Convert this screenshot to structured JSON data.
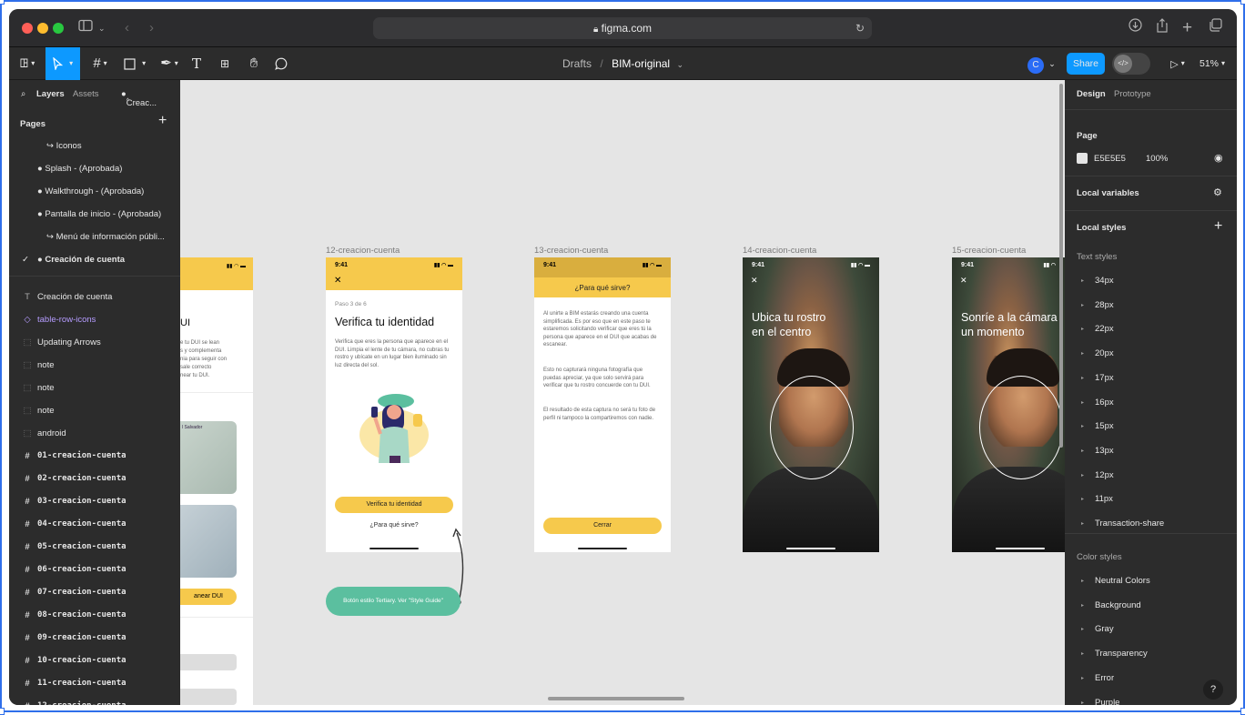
{
  "browser": {
    "url": "figma.com"
  },
  "toolbar": {
    "breadcrumb_drafts": "Drafts",
    "breadcrumb_separator": "/",
    "file_name": "BIM-original",
    "avatar_letter": "C",
    "share_label": "Share",
    "zoom": "51%"
  },
  "left_panel": {
    "tabs": {
      "layers": "Layers",
      "assets": "Assets",
      "page_dropdown": "Creac..."
    },
    "pages_header": "Pages",
    "pages": [
      {
        "label": "↪ Iconos"
      },
      {
        "label": "● Splash - (Aprobada)"
      },
      {
        "label": "● Walkthrough - (Aprobada)"
      },
      {
        "label": "● Pantalla de inicio - (Aprobada)"
      },
      {
        "label": "↪ Menú de información públi..."
      },
      {
        "label": "● Creación de cuenta",
        "selected": true
      }
    ],
    "layers": [
      {
        "icon": "text-icon",
        "label": "Creación de cuenta"
      },
      {
        "icon": "component-icon",
        "label": "table-row-icons",
        "color": "#b59cff"
      },
      {
        "icon": "section-icon",
        "label": "Updating Arrows"
      },
      {
        "icon": "section-icon",
        "label": "note"
      },
      {
        "icon": "section-icon",
        "label": "note"
      },
      {
        "icon": "section-icon",
        "label": "note"
      },
      {
        "icon": "section-icon",
        "label": "android"
      },
      {
        "icon": "frame-icon",
        "label": "01-creacion-cuenta"
      },
      {
        "icon": "frame-icon",
        "label": "02-creacion-cuenta"
      },
      {
        "icon": "frame-icon",
        "label": "03-creacion-cuenta"
      },
      {
        "icon": "frame-icon",
        "label": "04-creacion-cuenta"
      },
      {
        "icon": "frame-icon",
        "label": "05-creacion-cuenta"
      },
      {
        "icon": "frame-icon",
        "label": "06-creacion-cuenta"
      },
      {
        "icon": "frame-icon",
        "label": "07-creacion-cuenta"
      },
      {
        "icon": "frame-icon",
        "label": "08-creacion-cuenta"
      },
      {
        "icon": "frame-icon",
        "label": "09-creacion-cuenta"
      },
      {
        "icon": "frame-icon",
        "label": "10-creacion-cuenta"
      },
      {
        "icon": "frame-icon",
        "label": "11-creacion-cuenta"
      },
      {
        "icon": "frame-icon",
        "label": "12-creacion-cuenta"
      }
    ]
  },
  "canvas": {
    "partial_frame": {
      "title_fragment": "UI",
      "body_lines": [
        "e tu DUI se lean",
        "s y complementa",
        "nia para seguir con",
        "sale correcto",
        "near tu DUI."
      ],
      "id_label": "l Salvador",
      "button": "anear DUI"
    },
    "frame12": {
      "label": "12-creacion-cuenta",
      "time": "9:41",
      "step": "Paso 3 de 6",
      "title": "Verifica tu identidad",
      "body": "Verifica que eres la persona que aparece en el DUI. Limpia el lente de tu cámara, no cubras tu rostro y ubícate en un lugar bien iluminado sin luz directa del sol.",
      "button": "Verifica tu identidad",
      "link": "¿Para qué sirve?"
    },
    "note": "Botón estilo Tertiary. Ver \"Style Guide\"",
    "frame13": {
      "label": "13-creacion-cuenta",
      "time": "9:41",
      "header": "¿Para qué sirve?",
      "p1": "Al unirte a BIM estarás creando una cuenta simplificada. Es por eso que en este paso te estaremos solicitando verificar que eres tú la persona que aparece en el DUI que acabas de escanear.",
      "p2": "Esto no capturará ninguna fotografía que puedas apreciar, ya que solo servirá para verificar que tu rostro concuerde con tu DUI.",
      "p3": "El resultado de esta captura no será tu foto de perfil ni tampoco la compartiremos con nadie.",
      "button": "Cerrar"
    },
    "frame14": {
      "label": "14-creacion-cuenta",
      "time": "9:41",
      "title_l1": "Ubica tu rostro",
      "title_l2": "en el centro"
    },
    "frame15": {
      "label": "15-creacion-cuenta",
      "time": "9:41",
      "title_l1": "Sonríe a la cámara",
      "title_l2": "un momento"
    }
  },
  "right_panel": {
    "tabs": {
      "design": "Design",
      "prototype": "Prototype"
    },
    "page_header": "Page",
    "page_color": "E5E5E5",
    "page_opacity": "100%",
    "local_variables": "Local variables",
    "local_styles": "Local styles",
    "text_styles_header": "Text styles",
    "text_styles": [
      "34px",
      "28px",
      "22px",
      "20px",
      "17px",
      "16px",
      "15px",
      "13px",
      "12px",
      "11px",
      "Transaction-share"
    ],
    "color_styles_header": "Color styles",
    "color_styles": [
      "Neutral Colors",
      "Background",
      "Gray",
      "Transparency",
      "Error",
      "Purple"
    ],
    "help": "?"
  },
  "colors": {
    "accent": "#0d99ff",
    "brand_yellow": "#f6c94c",
    "note_green": "#5bbf9f",
    "canvas_bg": "#e5e5e5"
  }
}
